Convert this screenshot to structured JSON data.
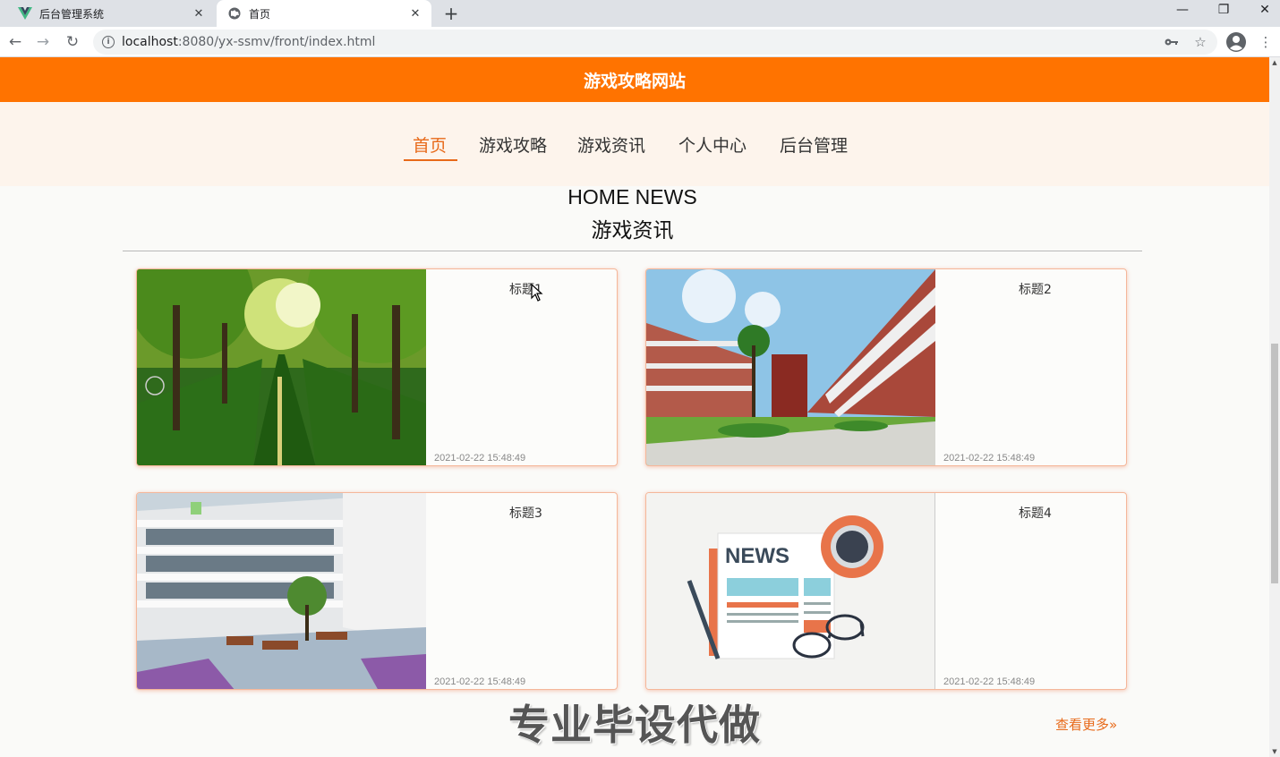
{
  "browser": {
    "tabs": [
      {
        "title": "后台管理系统",
        "active": false
      },
      {
        "title": "首页",
        "active": true
      }
    ],
    "url_host": "localhost",
    "url_rest": ":8080/yx-ssmv/front/index.html",
    "icons": [
      "back-icon",
      "forward-icon",
      "reload-icon",
      "info-icon",
      "key-icon",
      "star-icon",
      "profile-icon",
      "menu-icon"
    ]
  },
  "site": {
    "title": "游戏攻略网站",
    "brand_color": "#ff7300",
    "accent_color": "#e86a1a",
    "nav": [
      {
        "label": "首页",
        "active": true
      },
      {
        "label": "游戏攻略",
        "active": false
      },
      {
        "label": "游戏资讯",
        "active": false
      },
      {
        "label": "个人中心",
        "active": false
      },
      {
        "label": "后台管理",
        "active": false
      }
    ]
  },
  "section": {
    "title_en": "HOME NEWS",
    "title_cn": "游戏资讯",
    "more_label": "查看更多"
  },
  "news": [
    {
      "title": "标题1",
      "date": "2021-02-22 15:48:49",
      "image": "tree-lined-road"
    },
    {
      "title": "标题2",
      "date": "2021-02-22 15:48:49",
      "image": "campus-building"
    },
    {
      "title": "标题3",
      "date": "2021-02-22 15:48:49",
      "image": "school-courtyard"
    },
    {
      "title": "标题4",
      "date": "2021-02-22 15:48:49",
      "image": "news-illustration",
      "image_text": "NEWS"
    }
  ],
  "overlay_watermark": "专业毕设代做"
}
